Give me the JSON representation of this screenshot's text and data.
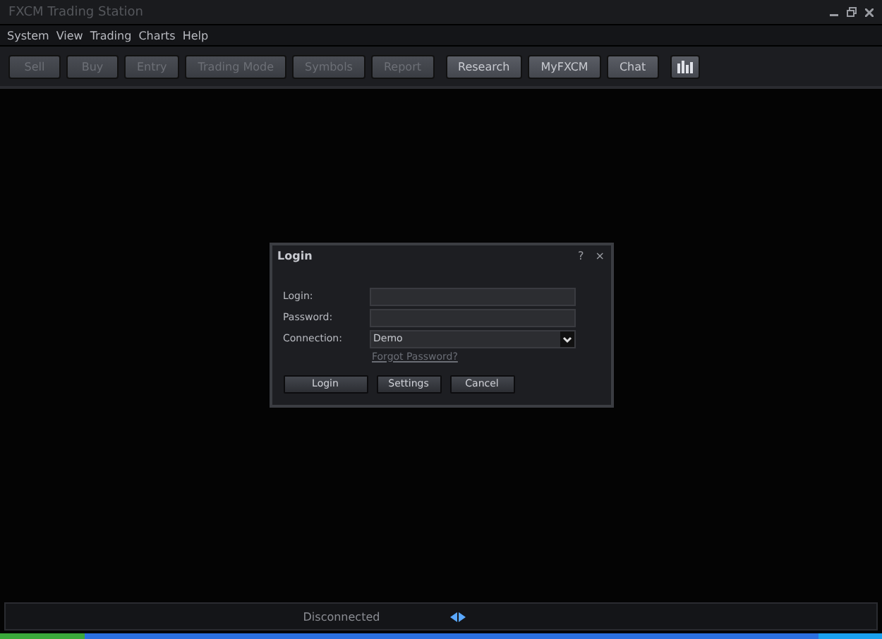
{
  "window": {
    "title": "FXCM Trading Station"
  },
  "menu": [
    "System",
    "View",
    "Trading",
    "Charts",
    "Help"
  ],
  "toolbar": [
    {
      "label": "Sell",
      "disabled": true
    },
    {
      "label": "Buy",
      "disabled": true
    },
    {
      "label": "Entry",
      "disabled": true
    },
    {
      "label": "Trading Mode",
      "disabled": true
    },
    {
      "label": "Symbols",
      "disabled": true
    },
    {
      "label": "Report",
      "disabled": true
    },
    {
      "label": "Research",
      "disabled": false,
      "gap": true
    },
    {
      "label": "MyFXCM",
      "disabled": false
    },
    {
      "label": "Chat",
      "disabled": false
    }
  ],
  "dialog": {
    "title": "Login",
    "help": "?",
    "close": "×",
    "fields": [
      {
        "label": "Login:",
        "kind": "text"
      },
      {
        "label": "Password:",
        "kind": "password"
      },
      {
        "label": "Connection:",
        "kind": "select",
        "value": "Demo"
      }
    ],
    "link": "Forgot Password?",
    "buttons": [
      "Login",
      "Settings",
      "Cancel"
    ]
  },
  "status_bar": {
    "text": "Disconnected"
  }
}
